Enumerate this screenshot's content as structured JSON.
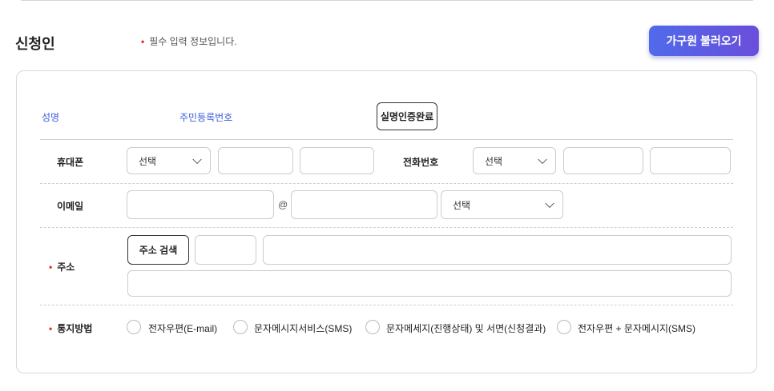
{
  "header": {
    "title": "신청인",
    "required_note": "필수 입력 정보입니다.",
    "family_button": "가구원 불러오기"
  },
  "identity": {
    "name_label": "성명",
    "rrn_label": "주민등록번호",
    "verify_button": "실명인증완료"
  },
  "mobile": {
    "label": "휴대폰",
    "carrier_select": "선택"
  },
  "phone": {
    "label": "전화번호",
    "area_select": "선택"
  },
  "email": {
    "label": "이메일",
    "at": "@",
    "domain_select": "선택"
  },
  "address": {
    "label": "주소",
    "search_button": "주소 검색"
  },
  "notify": {
    "label": "통지방법",
    "options": [
      "전자우편(E-mail)",
      "문자메시지서비스(SMS)",
      "문자메세지(진행상태) 및 서면(신청결과)",
      "전자우편 + 문자메시지(SMS)"
    ]
  },
  "colors": {
    "accent_start": "#4f6bea",
    "accent_end": "#6b4ddb",
    "label_blue": "#3b5bdb",
    "required_red": "#e03030"
  }
}
